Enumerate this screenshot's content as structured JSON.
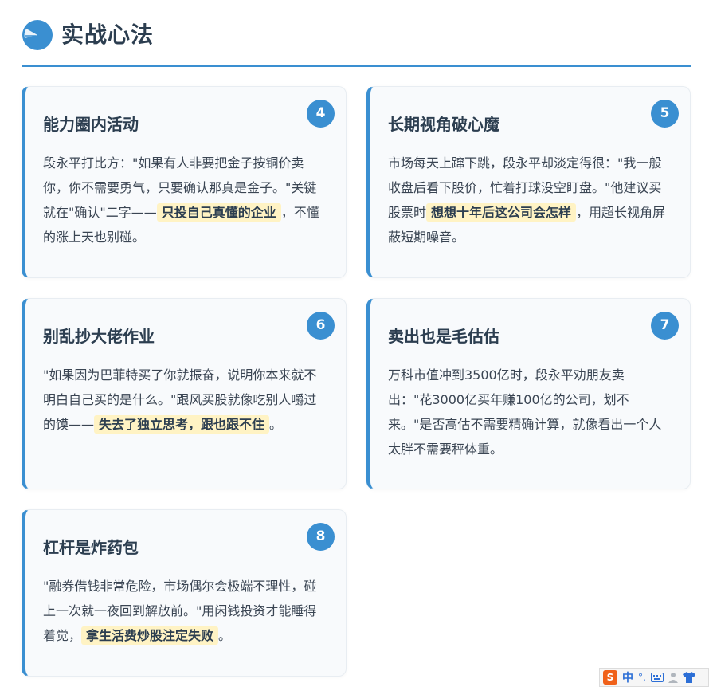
{
  "header": {
    "title": "实战心法",
    "accent": "#3a8fd1"
  },
  "cards": [
    {
      "num": "4",
      "title": "能力圈内活动",
      "text_before": "段永平打比方：\"如果有人非要把金子按铜价卖你，你不需要勇气，只要确认那真是金子。\"关键就在\"确认\"二字——",
      "highlight": "只投自己真懂的企业",
      "text_after": "，不懂的涨上天也别碰。"
    },
    {
      "num": "5",
      "title": "长期视角破心魔",
      "text_before": "市场每天上蹿下跳，段永平却淡定得很：\"我一般收盘后看下股价，忙着打球没空盯盘。\"他建议买股票时",
      "highlight": "想想十年后这公司会怎样",
      "text_after": "，用超长视角屏蔽短期噪音。"
    },
    {
      "num": "6",
      "title": "别乱抄大佬作业",
      "text_before": "\"如果因为巴菲特买了你就振奋，说明你本来就不明白自己买的是什么。\"跟风买股就像吃别人嚼过的馍——",
      "highlight": "失去了独立思考，跟也跟不住",
      "text_after": "。"
    },
    {
      "num": "7",
      "title": "卖出也是毛估估",
      "text_before": "万科市值冲到3500亿时，段永平劝朋友卖出：\"花3000亿买年赚100亿的公司，划不来。\"是否高估不需要精确计算，就像看出一个人太胖不需要秤体重。",
      "highlight": "",
      "text_after": ""
    },
    {
      "num": "8",
      "title": "杠杆是炸药包",
      "text_before": "\"融券借钱非常危险，市场偶尔会极端不理性，碰上一次就一夜回到解放前。\"用闲钱投资才能睡得着觉，",
      "highlight": "拿生活费炒股注定失败",
      "text_after": "。"
    }
  ],
  "ime": {
    "logo": "S",
    "mode": "中",
    "punct": "°,",
    "keyboard_icon": "keyboard-icon",
    "user_icon": "user-icon",
    "skin_icon": "shirt-icon"
  }
}
